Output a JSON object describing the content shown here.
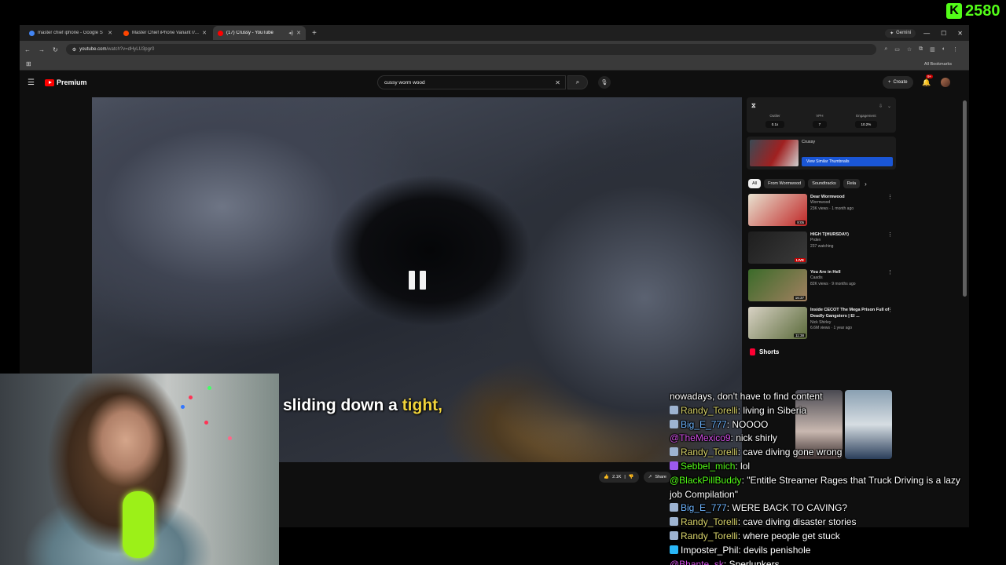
{
  "overlay": {
    "kick_logo": "K",
    "viewer_count": "2580",
    "caption_prefix": "sliding down a ",
    "caption_highlight": "tight,"
  },
  "browser": {
    "tabs": [
      {
        "title": "master chief iphone - Google S",
        "active": false,
        "favicon_color": "#4285f4"
      },
      {
        "title": "Master Chief iPhone Variant r/...",
        "active": false,
        "favicon_color": "#ff4500"
      },
      {
        "title": "(17) Crussy - YouTube",
        "active": true,
        "favicon_color": "#ff0000"
      }
    ],
    "new_tab_icon": "plus-icon",
    "gemini_label": "Gemini",
    "url": "youtube.com",
    "url_path": "/watch?v=dHyLU3pgr0",
    "all_bookmarks": "All Bookmarks"
  },
  "youtube": {
    "logo_text": "Premium",
    "search_query": "cussy worm wood",
    "create_label": "Create",
    "notification_count": "9+",
    "actions": {
      "likes": "2.1K",
      "share": "Share"
    },
    "extension": {
      "metrics": [
        {
          "label": "Outlier",
          "value": "0.1x"
        },
        {
          "label": "VPH",
          "value": "7"
        },
        {
          "label": "Engagement",
          "value": "10.2%"
        }
      ],
      "thumb_title": "Crussy",
      "similar_button": "View Similar Thumbnails"
    },
    "chips": [
      {
        "label": "All",
        "active": true
      },
      {
        "label": "From Wormwood",
        "active": false
      },
      {
        "label": "Soundtracks",
        "active": false
      },
      {
        "label": "Rela",
        "active": false
      }
    ],
    "recommendations": [
      {
        "title": "Dear Wormwood",
        "channel": "Wormwood",
        "meta": "23K views · 1 month ago",
        "badge": "8:05",
        "live": false,
        "color1": "#e8e2d0",
        "color2": "#c02626"
      },
      {
        "title": "HIGH T(HURSDAY)",
        "channel": "Prden",
        "meta": "237 watching",
        "badge": "LIVE",
        "live": true,
        "color1": "#1e1e1e",
        "color2": "#3a3a3a"
      },
      {
        "title": "You Are in Hell",
        "channel": "Caadis",
        "meta": "82K views · 9 months ago",
        "badge": "16:37",
        "live": false,
        "color1": "#3b6b2a",
        "color2": "#a28060"
      },
      {
        "title": "Inside CECOT The Mega Prison Full of Deadly Gangsters | El ...",
        "channel": "Nick Shirley",
        "meta": "6.6M views · 1 year ago",
        "badge": "11:38",
        "live": false,
        "color1": "#d8d2c4",
        "color2": "#5a6a3a"
      }
    ],
    "shorts_label": "Shorts"
  },
  "chat": [
    {
      "user": "",
      "text": "nowadays, don't have to find content",
      "color": "#ffffff",
      "badge": ""
    },
    {
      "user": "Randy_Torelli",
      "text": "living in Siberia",
      "color": "#d8d36a",
      "badge": "default"
    },
    {
      "user": "Big_E_777",
      "text": "NOOOO",
      "color": "#6eb5ff",
      "badge": "default"
    },
    {
      "user": "@TheMexico9",
      "text": "nick shirly",
      "color": "#d24fe6",
      "badge": ""
    },
    {
      "user": "Randy_Torelli",
      "text": "cave diving gone wrong",
      "color": "#d8d36a",
      "badge": "default"
    },
    {
      "user": "Sebbel_mich",
      "text": "lol",
      "color": "#53fc18",
      "badge": "purple"
    },
    {
      "user": "@BlackPillBuddy",
      "text": "\"Entitle Streamer Rages that Truck Driving is a lazy job Compilation\"",
      "color": "#53fc18",
      "badge": ""
    },
    {
      "user": "Big_E_777",
      "text": "WERE BACK TO CAVING?",
      "color": "#6eb5ff",
      "badge": "default"
    },
    {
      "user": "Randy_Torelli",
      "text": "cave diving disaster stories",
      "color": "#d8d36a",
      "badge": "default"
    },
    {
      "user": "Randy_Torelli",
      "text": "where people get stuck",
      "color": "#d8d36a",
      "badge": "default"
    },
    {
      "user": "Imposter_Phil",
      "text": "devils penishole",
      "color": "#ffffff",
      "badge": "cube"
    },
    {
      "user": "@Bhante_sk",
      "text": "Sperlunkers",
      "color": "#d24fe6",
      "badge": ""
    }
  ]
}
